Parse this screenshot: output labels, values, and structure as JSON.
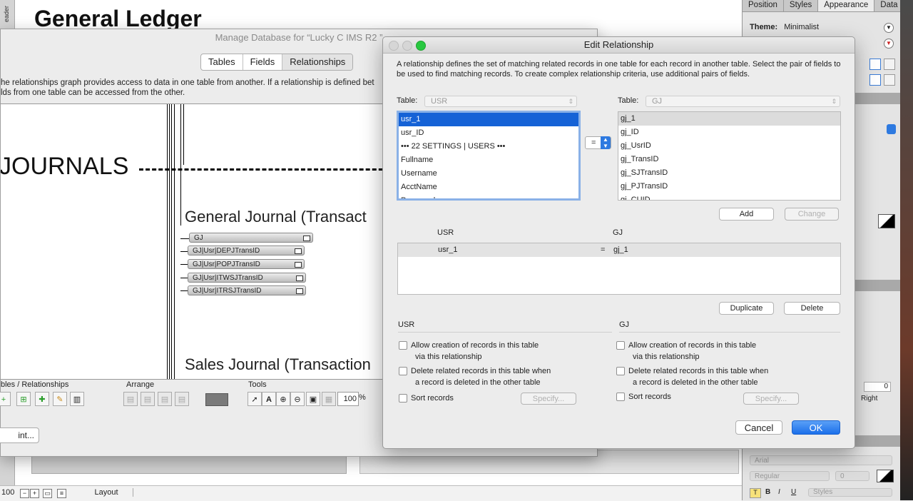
{
  "layout": {
    "title": "General Ledger",
    "left_strip_label": "eader",
    "status": {
      "zoom": "100",
      "mode": "Layout"
    }
  },
  "manage_db": {
    "title": "Manage Database for “Lucky C IMS R2 ”",
    "tabs": [
      "Tables",
      "Fields",
      "Relationships"
    ],
    "selected_tab": "Relationships",
    "description_1": "he relationships graph provides access to data in one table from another. If a relationship is defined bet",
    "description_2": "lds from one table can be accessed from the other.",
    "graph": {
      "journals_heading": "JOURNALS",
      "gj_heading": "General Journal (Transact",
      "sj_heading": "Sales Journal (Transaction",
      "table_occurrences": [
        "GJ",
        "GJ|Usr|DEPJTransID",
        "GJ|Usr|POPJTransID",
        "GJ|Usr|ITWSJTransID",
        "GJ|Usr|ITRSJTransID"
      ]
    },
    "toolbar": {
      "tables_label": "bles / Relationships",
      "arrange_label": "Arrange",
      "tools_label": "Tools",
      "zoom_value": "100",
      "zoom_unit": "%"
    },
    "print_label": "int..."
  },
  "inspector": {
    "tabs": [
      "Position",
      "Styles",
      "Appearance",
      "Data"
    ],
    "active_tab": "Appearance",
    "theme_label": "Theme:",
    "theme_value": "Minimalist",
    "spin_value": "0",
    "right_label": "Right",
    "font_name": "Arial",
    "font_style": "Regular",
    "font_size": "0",
    "styles_label": "Styles"
  },
  "dialog": {
    "title": "Edit Relationship",
    "description": "A relationship defines the set of matching related records in one table for each record in another table. Select the pair of fields to be used to find matching records. To create complex relationship criteria, use additional pairs of fields.",
    "table_label": "Table:",
    "left_table": "USR",
    "right_table": "GJ",
    "left_fields": [
      "usr_1",
      "usr_ID",
      "••• 22 SETTINGS | USERS •••",
      "Fullname",
      "Username",
      "AcctName",
      "Password"
    ],
    "right_fields": [
      "gj_1",
      "gj_ID",
      "gj_UsrID",
      "gj_TransID",
      "gj_SJTransID",
      "gj_PJTransID",
      "gj_CUID"
    ],
    "operator": "=",
    "add_label": "Add",
    "change_label": "Change",
    "criteria_header_left": "USR",
    "criteria_header_right": "GJ",
    "criteria": [
      {
        "left": "usr_1",
        "op": "=",
        "right": "gj_1"
      }
    ],
    "duplicate_label": "Duplicate",
    "delete_label": "Delete",
    "left_options": {
      "section": "USR",
      "allow_creation_1": "Allow creation of records in this table",
      "allow_creation_2": "via this relationship",
      "delete_related_1": "Delete related records in this table when",
      "delete_related_2": "a record is deleted in the other table",
      "sort_records": "Sort records",
      "specify": "Specify..."
    },
    "right_options": {
      "section": "GJ",
      "allow_creation_1": "Allow creation of records in this table",
      "allow_creation_2": "via this relationship",
      "delete_related_1": "Delete related records in this table when",
      "delete_related_2": "a record is deleted in the other table",
      "sort_records": "Sort records",
      "specify": "Specify..."
    },
    "cancel_label": "Cancel",
    "ok_label": "OK"
  },
  "colors": {
    "accent": "#1b6fea",
    "selection": "#1562d6",
    "close": "#d9d9d9",
    "zoom_green": "#28c840"
  }
}
